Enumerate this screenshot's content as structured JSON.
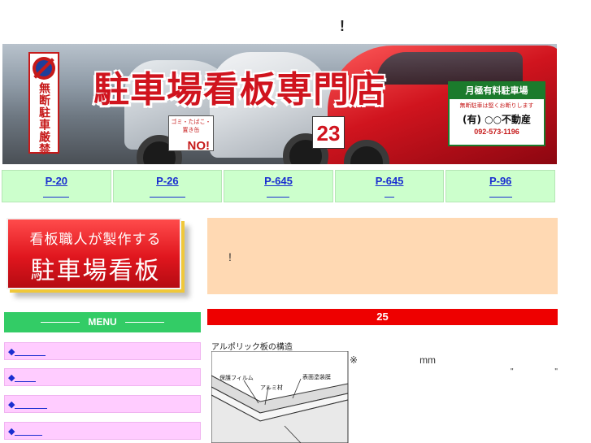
{
  "page": {
    "top_title": "!"
  },
  "banner": {
    "title": "駐車場看板専門店",
    "left_sign_text": "無断駐車厳禁",
    "no_sign_caption": "ゴミ・たばこ・置き缶",
    "no_sign_label": "NO!",
    "space_number": "23",
    "right_sign": {
      "heading": "月極有料駐車場",
      "subtext": "無断駐車は堅くお断りします",
      "company": "(有) ○○不動産",
      "phone": "092-573-1196"
    }
  },
  "nav": {
    "items": [
      {
        "code": "P-20"
      },
      {
        "code": "P-26"
      },
      {
        "code": "P-645"
      },
      {
        "code": "P-645"
      },
      {
        "code": "P-96"
      }
    ]
  },
  "side_banner": {
    "line1": "看板職人が製作する",
    "line2": "駐車場看板"
  },
  "menu": {
    "heading": "MENU",
    "bullet": "◆",
    "items": [
      "",
      "",
      "",
      ""
    ]
  },
  "notice": {
    "text": "!"
  },
  "red_bar": {
    "text": "25"
  },
  "diagram": {
    "caption": "アルポリック板の構造",
    "label_film": "保護フィルム",
    "label_coating": "表面塗装膜",
    "label_aluminum": "アルミ材"
  },
  "notes": {
    "mark": "※",
    "unit": "mm",
    "quotes": "\" \""
  },
  "colors": {
    "nav_bg": "#ccffcc",
    "link": "#1a2ed0",
    "menu_head": "#33cc66",
    "menu_item_bg": "#ffccff",
    "notice_bg": "#ffd9b3",
    "red_bar": "#ee0000"
  }
}
